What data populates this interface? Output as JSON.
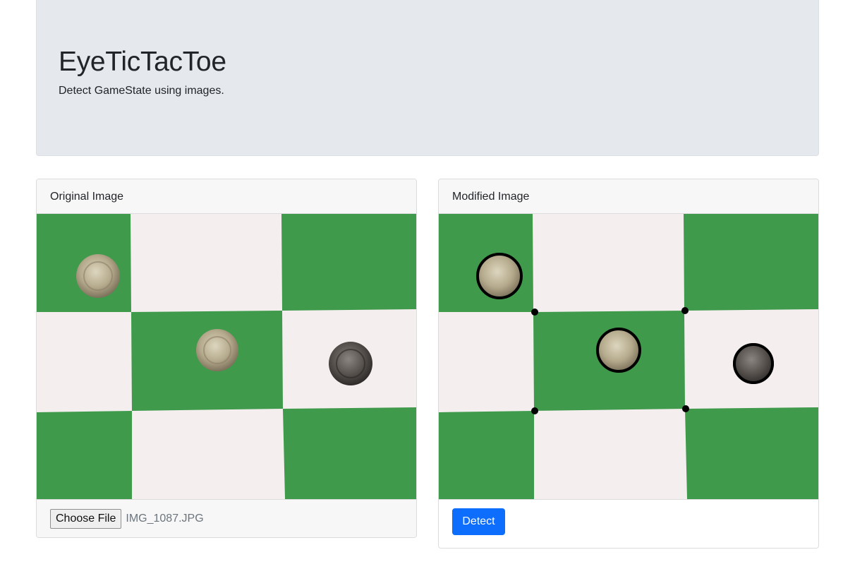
{
  "header": {
    "title": "EyeTicTacToe",
    "subtitle": "Detect GameState using images."
  },
  "original_card": {
    "title": "Original Image",
    "choose_button": "Choose File",
    "file_name": "IMG_1087.JPG"
  },
  "modified_card": {
    "title": "Modified Image",
    "detect_button": "Detect"
  },
  "colors": {
    "board_green": "#3f9a4c",
    "board_white": "#f4eeee",
    "primary_button": "#0d6efd",
    "jumbotron_bg": "#e5e8ed"
  }
}
